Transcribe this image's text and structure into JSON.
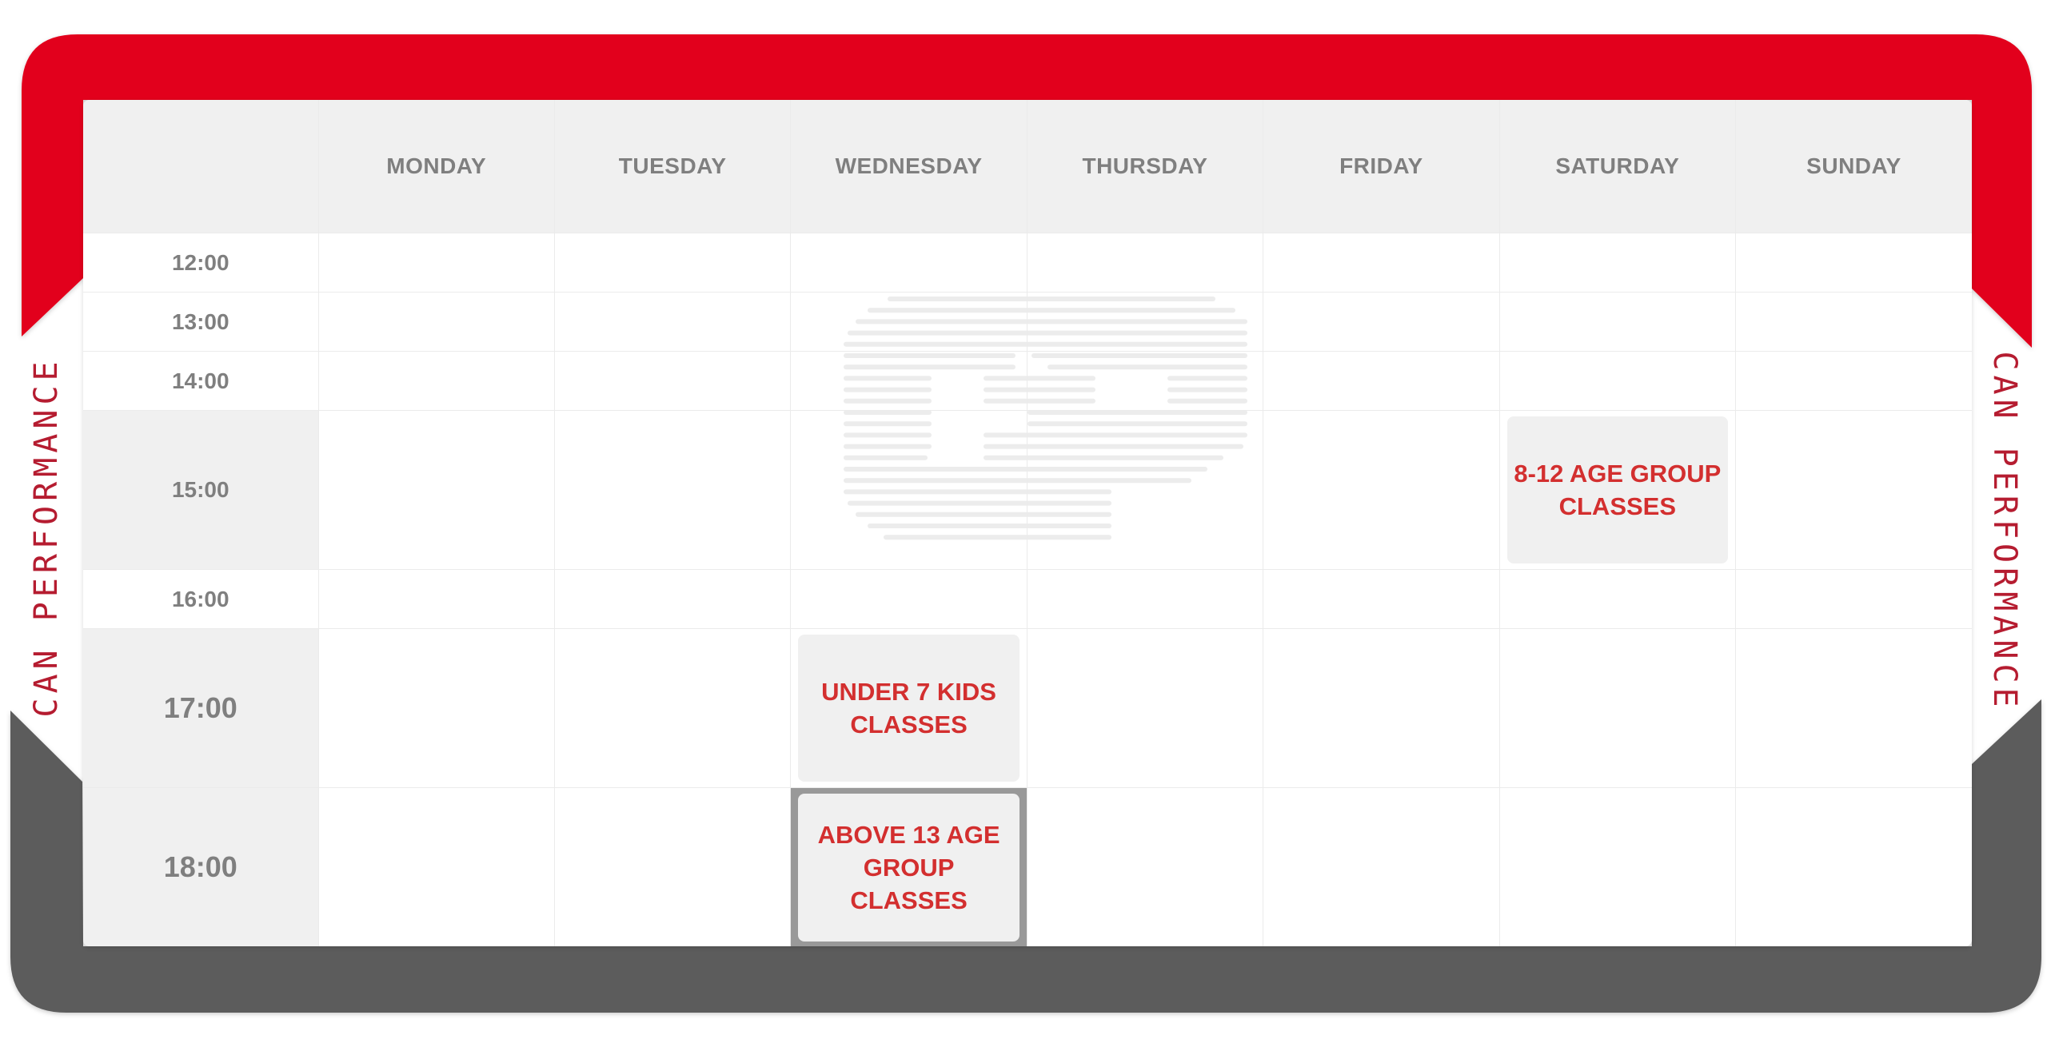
{
  "brand": {
    "side_label_left": "CAN PERFORMANCE",
    "side_label_right": "CAN PERFORMANCE",
    "watermark_icon": "cp-logo-icon",
    "colors": {
      "frame_top": "#e2001f",
      "frame_bottom": "#5c5c5c",
      "side_text": "#b51c30",
      "event_text": "#d32f2f",
      "header_bg": "#f0f0f0",
      "header_text": "#7f7f7f",
      "active_cell_bg": "#999999"
    }
  },
  "schedule": {
    "days": [
      "MONDAY",
      "TUESDAY",
      "WEDNESDAY",
      "THURSDAY",
      "FRIDAY",
      "SATURDAY",
      "SUNDAY"
    ],
    "times": [
      "12:00",
      "13:00",
      "14:00",
      "15:00",
      "16:00",
      "17:00",
      "18:00"
    ],
    "events": [
      {
        "day": "SATURDAY",
        "time": "15:00",
        "label": "8-12 AGE GROUP CLASSES"
      },
      {
        "day": "WEDNESDAY",
        "time": "17:00",
        "label": "UNDER 7 KIDS CLASSES"
      },
      {
        "day": "WEDNESDAY",
        "time": "18:00",
        "label": "ABOVE 13 AGE GROUP CLASSES",
        "highlighted": true
      }
    ]
  }
}
